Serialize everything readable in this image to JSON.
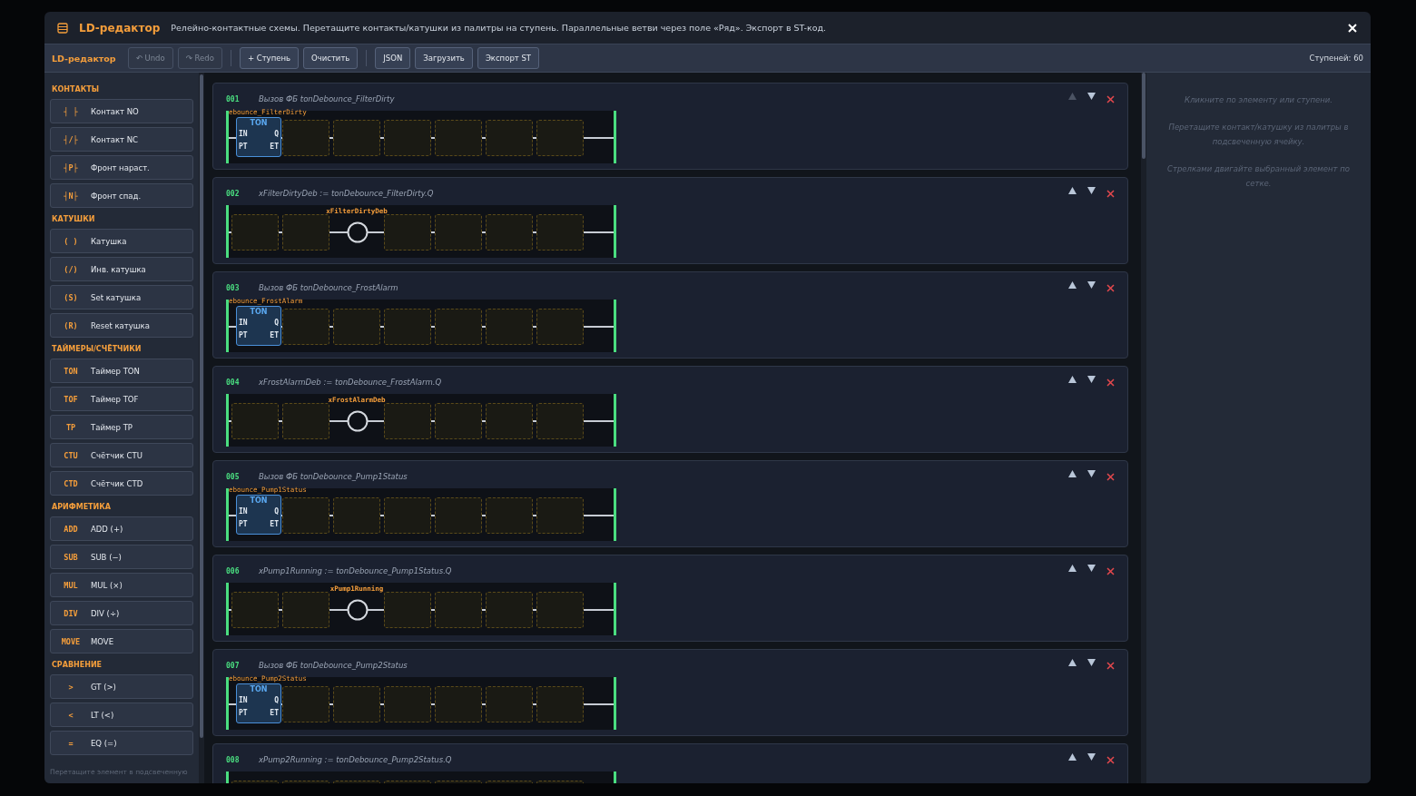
{
  "dialog": {
    "title": "LD-редактор",
    "description": "Релейно-контактные схемы. Перетащите контакты/катушки из палитры на ступень. Параллельные ветви через поле «Ряд». Экспорт в ST-код."
  },
  "toolbar": {
    "title": "LD-редактор",
    "groups": [
      [
        {
          "label": "↶ Undo",
          "disabled": true
        },
        {
          "label": "↷ Redo",
          "disabled": true
        }
      ],
      [
        {
          "label": "+ Ступень",
          "disabled": false
        },
        {
          "label": "Очистить",
          "disabled": false
        }
      ],
      [
        {
          "label": "JSON",
          "disabled": false
        },
        {
          "label": "Загрузить",
          "disabled": false
        },
        {
          "label": "Экспорт ST",
          "disabled": false
        }
      ]
    ],
    "count": "Ступеней: 60"
  },
  "palette": {
    "groups": [
      {
        "title": "КОНТАКТЫ",
        "items": [
          {
            "symbol": "┤ ├",
            "label": "Контакт NO"
          },
          {
            "symbol": "┤/├",
            "label": "Контакт NC"
          },
          {
            "symbol": "┤P├",
            "label": "Фронт нараст."
          },
          {
            "symbol": "┤N├",
            "label": "Фронт спад."
          }
        ]
      },
      {
        "title": "КАТУШКИ",
        "items": [
          {
            "symbol": "( )",
            "label": "Катушка"
          },
          {
            "symbol": "(/)",
            "label": "Инв. катушка"
          },
          {
            "symbol": "(S)",
            "label": "Set катушка"
          },
          {
            "symbol": "(R)",
            "label": "Reset катушка"
          }
        ]
      },
      {
        "title": "ТАЙМЕРЫ/СЧЁТЧИКИ",
        "items": [
          {
            "symbol": "TON",
            "label": "Таймер TON"
          },
          {
            "symbol": "TOF",
            "label": "Таймер TOF"
          },
          {
            "symbol": "TP",
            "label": "Таймер TP"
          },
          {
            "symbol": "CTU",
            "label": "Счётчик CTU"
          },
          {
            "symbol": "CTD",
            "label": "Счётчик CTD"
          }
        ]
      },
      {
        "title": "АРИФМЕТИКА",
        "items": [
          {
            "symbol": "ADD",
            "label": "ADD (+)"
          },
          {
            "symbol": "SUB",
            "label": "SUB (−)"
          },
          {
            "symbol": "MUL",
            "label": "MUL (×)"
          },
          {
            "symbol": "DIV",
            "label": "DIV (÷)"
          },
          {
            "symbol": "MOVE",
            "label": "MOVE"
          }
        ]
      },
      {
        "title": "СРАВНЕНИЕ",
        "items": [
          {
            "symbol": ">",
            "label": "GT (>)"
          },
          {
            "symbol": "<",
            "label": "LT (<)"
          },
          {
            "symbol": "=",
            "label": "EQ (=)"
          }
        ]
      }
    ],
    "footer": "Перетащите элемент в подсвеченную"
  },
  "rungs": [
    {
      "number": "001",
      "comment": "Вызов ФБ tonDebounce_FilterDirty",
      "kind": "fb",
      "up_disabled": true,
      "label": "ebounce_FilterDirty",
      "block": "TON",
      "inputs": [
        "IN",
        "PT"
      ],
      "outputs": [
        "Q",
        "ET"
      ]
    },
    {
      "number": "002",
      "comment": "xFilterDirtyDeb := tonDebounce_FilterDirty.Q",
      "kind": "coil",
      "up_disabled": false,
      "label": "xFilterDirtyDeb"
    },
    {
      "number": "003",
      "comment": "Вызов ФБ tonDebounce_FrostAlarm",
      "kind": "fb",
      "up_disabled": false,
      "label": "ebounce_FrostAlarm",
      "block": "TON",
      "inputs": [
        "IN",
        "PT"
      ],
      "outputs": [
        "Q",
        "ET"
      ]
    },
    {
      "number": "004",
      "comment": "xFrostAlarmDeb := tonDebounce_FrostAlarm.Q",
      "kind": "coil",
      "up_disabled": false,
      "label": "xFrostAlarmDeb"
    },
    {
      "number": "005",
      "comment": "Вызов ФБ tonDebounce_Pump1Status",
      "kind": "fb",
      "up_disabled": false,
      "label": "ebounce_Pump1Status",
      "block": "TON",
      "inputs": [
        "IN",
        "PT"
      ],
      "outputs": [
        "Q",
        "ET"
      ]
    },
    {
      "number": "006",
      "comment": "xPump1Running := tonDebounce_Pump1Status.Q",
      "kind": "coil",
      "up_disabled": false,
      "label": "xPump1Running"
    },
    {
      "number": "007",
      "comment": "Вызов ФБ tonDebounce_Pump2Status",
      "kind": "fb",
      "up_disabled": false,
      "label": "ebounce_Pump2Status",
      "block": "TON",
      "inputs": [
        "IN",
        "PT"
      ],
      "outputs": [
        "Q",
        "ET"
      ]
    },
    {
      "number": "008",
      "comment": "xPump2Running := tonDebounce_Pump2Status.Q",
      "kind": "partial",
      "up_disabled": false
    }
  ],
  "hints": [
    "Кликните по элементу или ступени.",
    "Перетащите контакт/катушку из палитры в подсвеченную ячейку.",
    "Стрелками двигайте выбранный элемент по сетке."
  ]
}
